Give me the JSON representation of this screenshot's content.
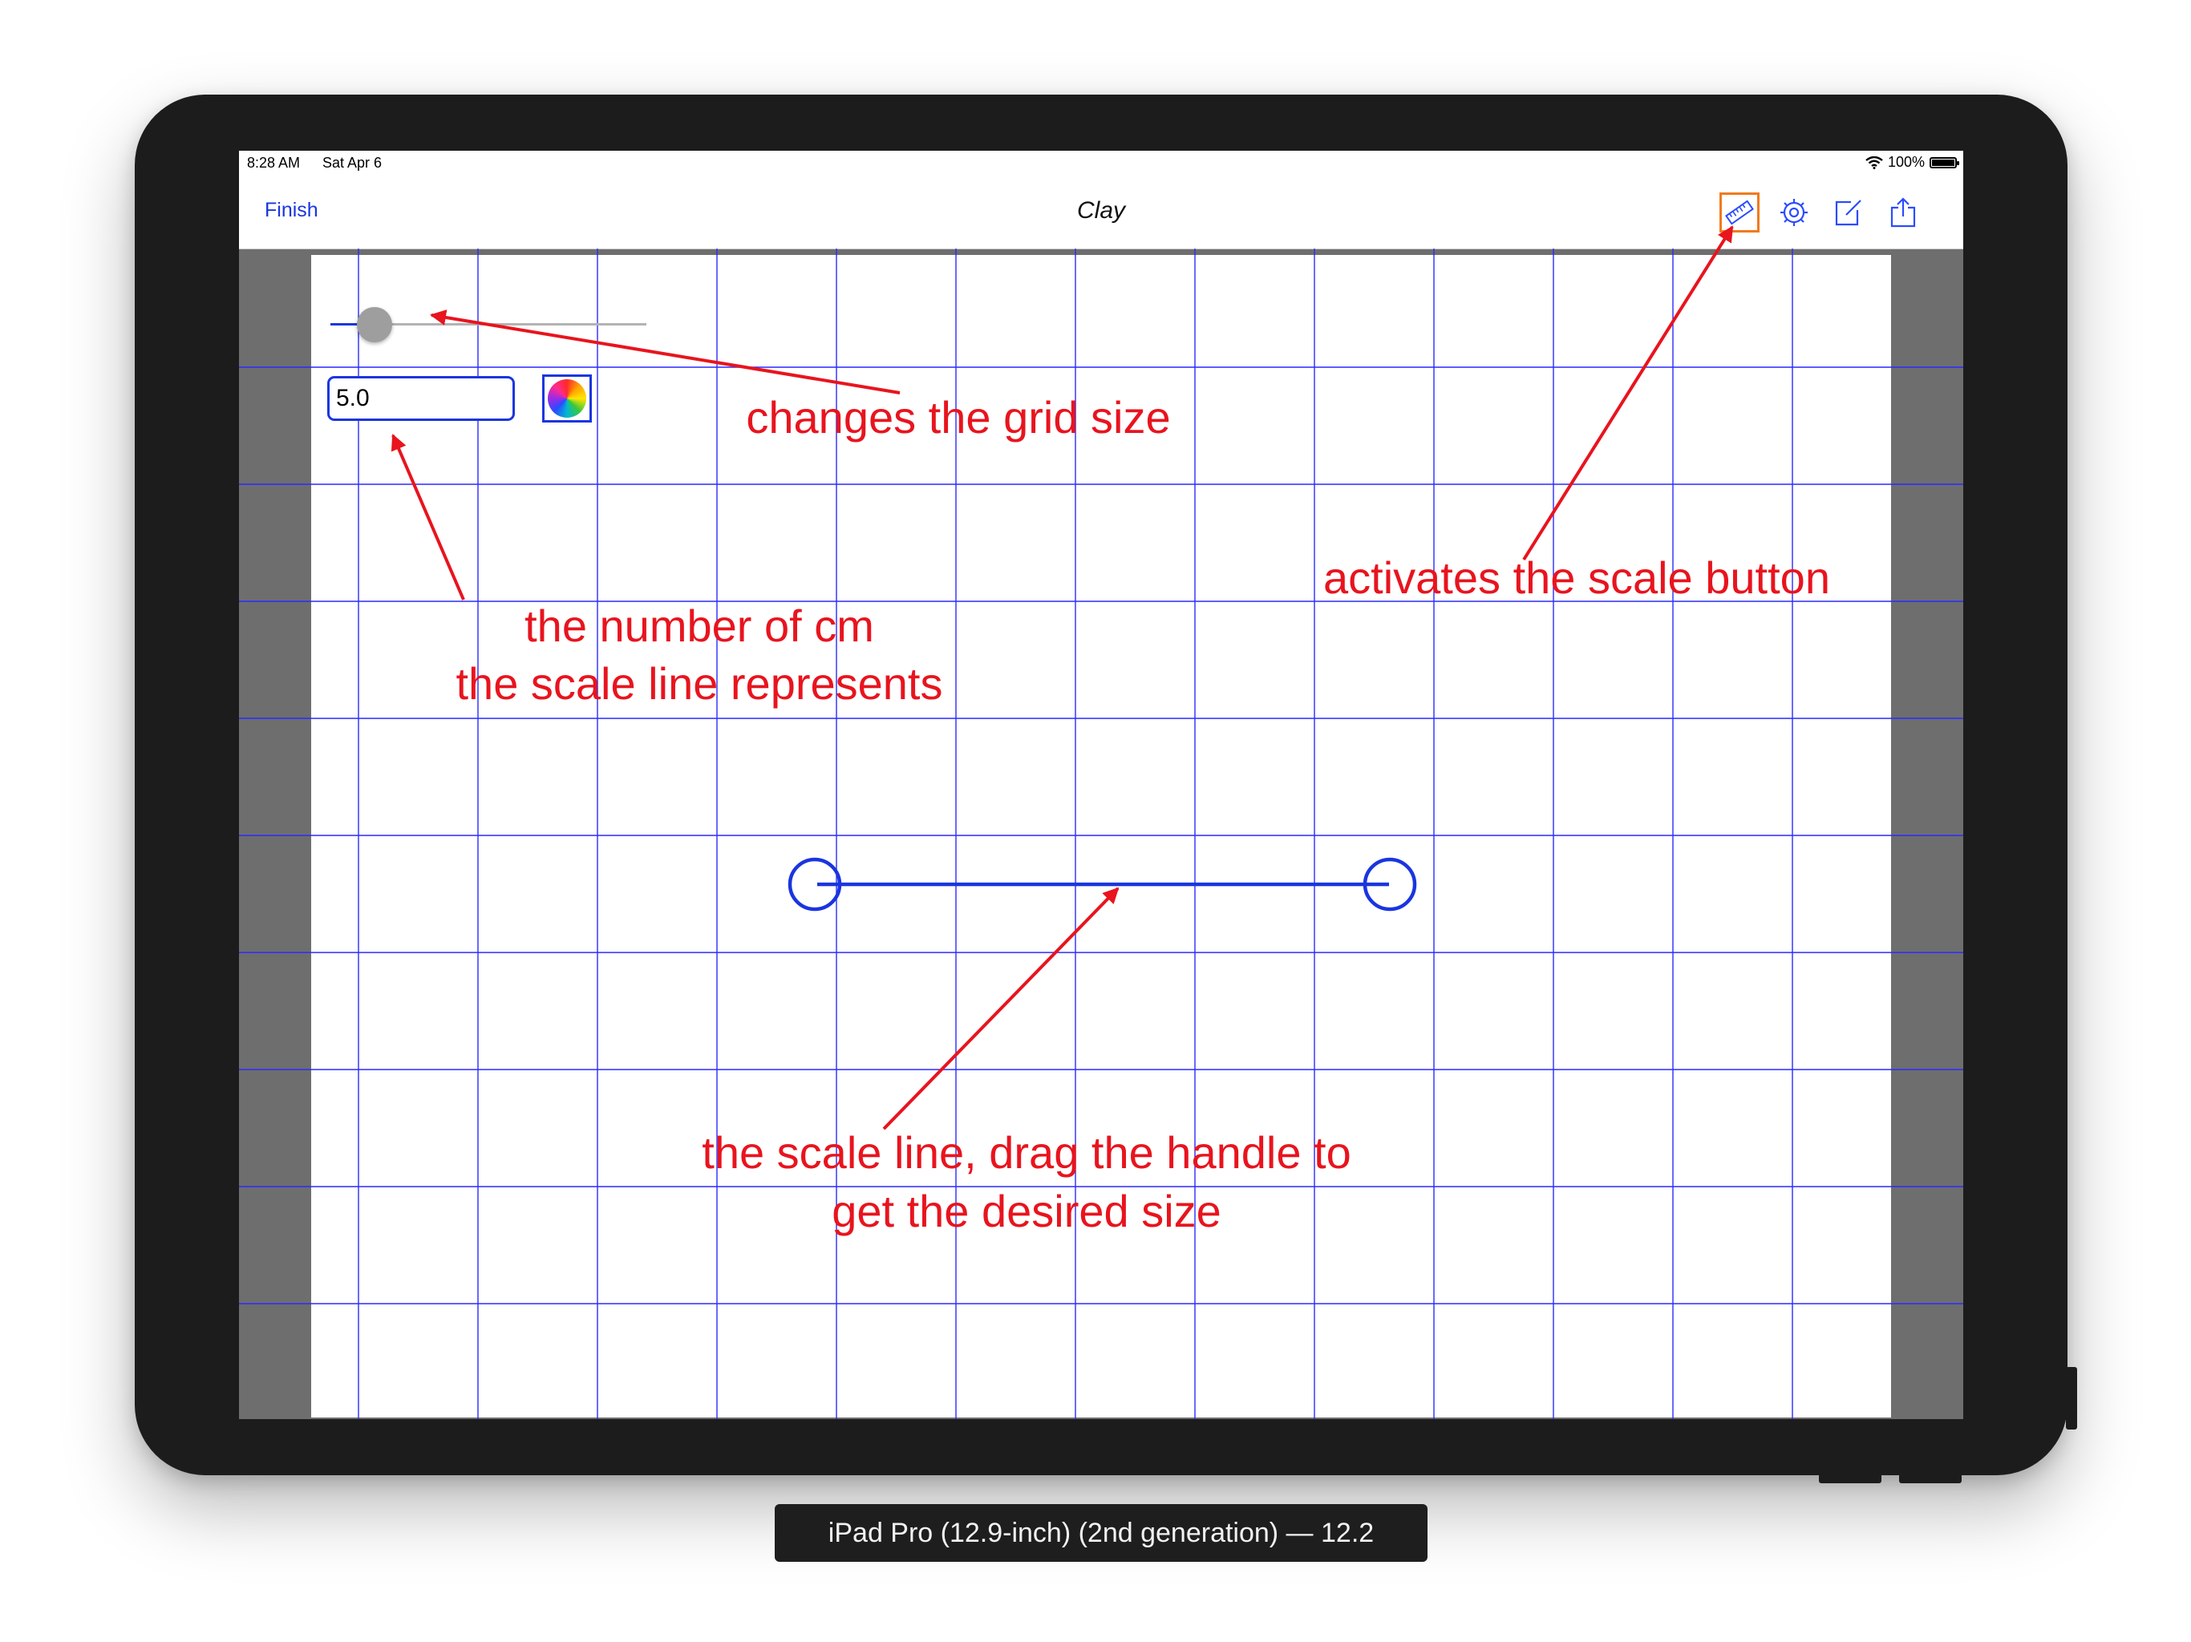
{
  "status_bar": {
    "time": "8:28 AM",
    "date": "Sat Apr 6",
    "battery": "100%"
  },
  "nav_bar": {
    "finish_label": "Finish",
    "title": "Clay",
    "icons": [
      "ruler-icon",
      "gear-icon",
      "compose-icon",
      "share-icon"
    ]
  },
  "grid_slider": {
    "value": 0.14
  },
  "scale_field": {
    "value": "5.0"
  },
  "annotations": {
    "grid_size": "changes the grid size",
    "scale_button": "activates the scale button",
    "cm_line1": "the number of cm",
    "cm_line2": "the scale line represents",
    "scale_line1": "the scale line, drag the handle to",
    "scale_line2": "get the desired size"
  },
  "device_label": "iPad Pro (12.9-inch) (2nd generation) — 12.2",
  "colors": {
    "accent": "#1a35e0",
    "annotation": "#e8141e",
    "active_tool": "#f07a1c",
    "grid": "#2a2aff"
  }
}
